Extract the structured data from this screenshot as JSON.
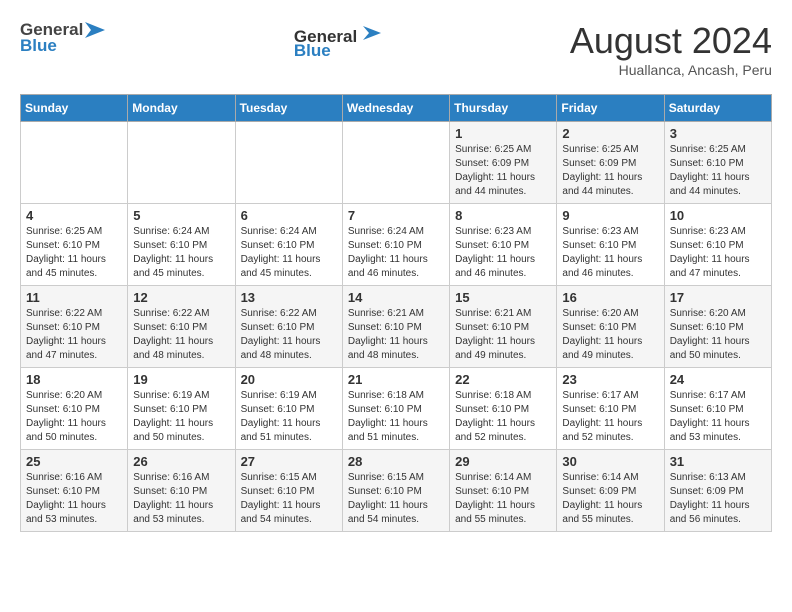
{
  "header": {
    "logo_general": "General",
    "logo_blue": "Blue",
    "month_year": "August 2024",
    "location": "Huallanca, Ancash, Peru"
  },
  "days_of_week": [
    "Sunday",
    "Monday",
    "Tuesday",
    "Wednesday",
    "Thursday",
    "Friday",
    "Saturday"
  ],
  "weeks": [
    [
      {
        "day": "",
        "info": ""
      },
      {
        "day": "",
        "info": ""
      },
      {
        "day": "",
        "info": ""
      },
      {
        "day": "",
        "info": ""
      },
      {
        "day": "1",
        "info": "Sunrise: 6:25 AM\nSunset: 6:09 PM\nDaylight: 11 hours and 44 minutes."
      },
      {
        "day": "2",
        "info": "Sunrise: 6:25 AM\nSunset: 6:09 PM\nDaylight: 11 hours and 44 minutes."
      },
      {
        "day": "3",
        "info": "Sunrise: 6:25 AM\nSunset: 6:10 PM\nDaylight: 11 hours and 44 minutes."
      }
    ],
    [
      {
        "day": "4",
        "info": "Sunrise: 6:25 AM\nSunset: 6:10 PM\nDaylight: 11 hours and 45 minutes."
      },
      {
        "day": "5",
        "info": "Sunrise: 6:24 AM\nSunset: 6:10 PM\nDaylight: 11 hours and 45 minutes."
      },
      {
        "day": "6",
        "info": "Sunrise: 6:24 AM\nSunset: 6:10 PM\nDaylight: 11 hours and 45 minutes."
      },
      {
        "day": "7",
        "info": "Sunrise: 6:24 AM\nSunset: 6:10 PM\nDaylight: 11 hours and 46 minutes."
      },
      {
        "day": "8",
        "info": "Sunrise: 6:23 AM\nSunset: 6:10 PM\nDaylight: 11 hours and 46 minutes."
      },
      {
        "day": "9",
        "info": "Sunrise: 6:23 AM\nSunset: 6:10 PM\nDaylight: 11 hours and 46 minutes."
      },
      {
        "day": "10",
        "info": "Sunrise: 6:23 AM\nSunset: 6:10 PM\nDaylight: 11 hours and 47 minutes."
      }
    ],
    [
      {
        "day": "11",
        "info": "Sunrise: 6:22 AM\nSunset: 6:10 PM\nDaylight: 11 hours and 47 minutes."
      },
      {
        "day": "12",
        "info": "Sunrise: 6:22 AM\nSunset: 6:10 PM\nDaylight: 11 hours and 48 minutes."
      },
      {
        "day": "13",
        "info": "Sunrise: 6:22 AM\nSunset: 6:10 PM\nDaylight: 11 hours and 48 minutes."
      },
      {
        "day": "14",
        "info": "Sunrise: 6:21 AM\nSunset: 6:10 PM\nDaylight: 11 hours and 48 minutes."
      },
      {
        "day": "15",
        "info": "Sunrise: 6:21 AM\nSunset: 6:10 PM\nDaylight: 11 hours and 49 minutes."
      },
      {
        "day": "16",
        "info": "Sunrise: 6:20 AM\nSunset: 6:10 PM\nDaylight: 11 hours and 49 minutes."
      },
      {
        "day": "17",
        "info": "Sunrise: 6:20 AM\nSunset: 6:10 PM\nDaylight: 11 hours and 50 minutes."
      }
    ],
    [
      {
        "day": "18",
        "info": "Sunrise: 6:20 AM\nSunset: 6:10 PM\nDaylight: 11 hours and 50 minutes."
      },
      {
        "day": "19",
        "info": "Sunrise: 6:19 AM\nSunset: 6:10 PM\nDaylight: 11 hours and 50 minutes."
      },
      {
        "day": "20",
        "info": "Sunrise: 6:19 AM\nSunset: 6:10 PM\nDaylight: 11 hours and 51 minutes."
      },
      {
        "day": "21",
        "info": "Sunrise: 6:18 AM\nSunset: 6:10 PM\nDaylight: 11 hours and 51 minutes."
      },
      {
        "day": "22",
        "info": "Sunrise: 6:18 AM\nSunset: 6:10 PM\nDaylight: 11 hours and 52 minutes."
      },
      {
        "day": "23",
        "info": "Sunrise: 6:17 AM\nSunset: 6:10 PM\nDaylight: 11 hours and 52 minutes."
      },
      {
        "day": "24",
        "info": "Sunrise: 6:17 AM\nSunset: 6:10 PM\nDaylight: 11 hours and 53 minutes."
      }
    ],
    [
      {
        "day": "25",
        "info": "Sunrise: 6:16 AM\nSunset: 6:10 PM\nDaylight: 11 hours and 53 minutes."
      },
      {
        "day": "26",
        "info": "Sunrise: 6:16 AM\nSunset: 6:10 PM\nDaylight: 11 hours and 53 minutes."
      },
      {
        "day": "27",
        "info": "Sunrise: 6:15 AM\nSunset: 6:10 PM\nDaylight: 11 hours and 54 minutes."
      },
      {
        "day": "28",
        "info": "Sunrise: 6:15 AM\nSunset: 6:10 PM\nDaylight: 11 hours and 54 minutes."
      },
      {
        "day": "29",
        "info": "Sunrise: 6:14 AM\nSunset: 6:10 PM\nDaylight: 11 hours and 55 minutes."
      },
      {
        "day": "30",
        "info": "Sunrise: 6:14 AM\nSunset: 6:09 PM\nDaylight: 11 hours and 55 minutes."
      },
      {
        "day": "31",
        "info": "Sunrise: 6:13 AM\nSunset: 6:09 PM\nDaylight: 11 hours and 56 minutes."
      }
    ]
  ]
}
